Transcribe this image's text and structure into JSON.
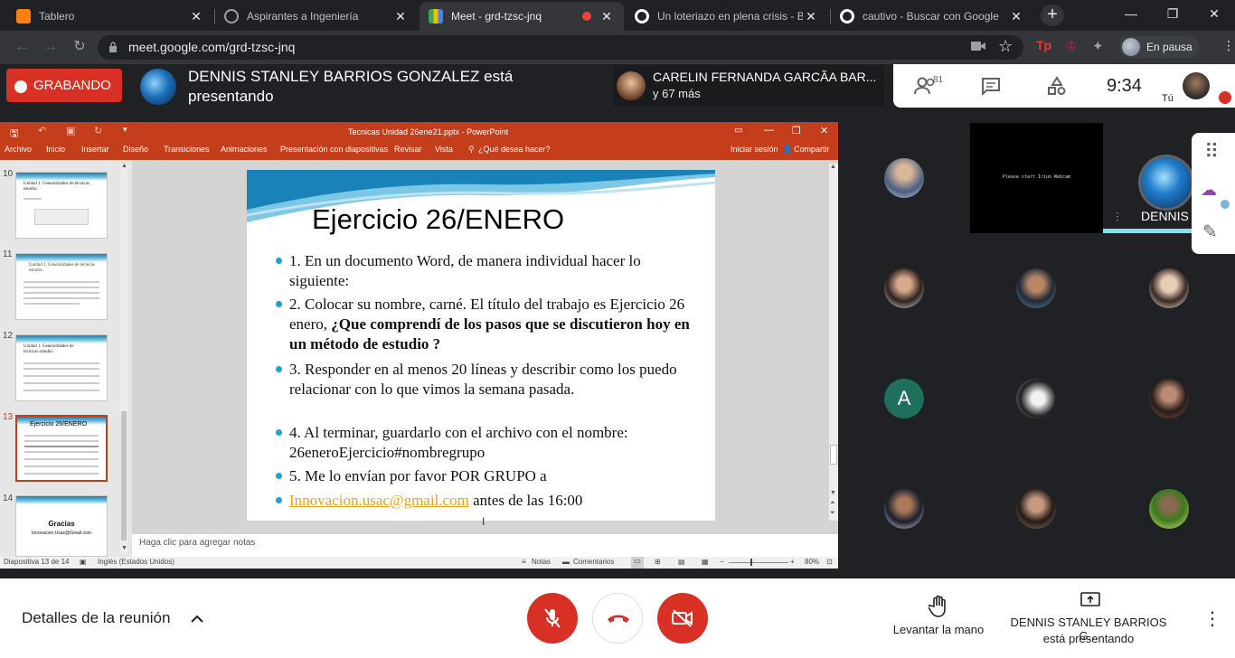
{
  "browser": {
    "tabs": [
      {
        "title": "Tablero",
        "icon": "moodle-icon"
      },
      {
        "title": "Aspirantes a Ingeniería",
        "icon": "globe-icon"
      },
      {
        "title": "Meet - grd-tzsc-jnq",
        "icon": "meet-icon"
      },
      {
        "title": "Un loteriazo en plena crisis - Bu",
        "icon": "google-icon"
      },
      {
        "title": "cautivo - Buscar con Google",
        "icon": "google-icon"
      }
    ],
    "url": "meet.google.com/grd-tzsc-jnq",
    "profile_status": "En pausa"
  },
  "meet": {
    "recording_label": "GRABANDO",
    "presenter_text": "DENNIS STANLEY BARRIOS GONZALEZ está presentando",
    "participants_name": "CARELIN FERNANDA GARCÃA BAR...",
    "participants_more": "y 67 más",
    "participant_count": "81",
    "time": "9:34",
    "self_label": "Tú",
    "tile_name": "DENNIS S",
    "tile_message": "Please start Iriun Webcam",
    "details_label": "Detalles de la reunión",
    "raise_hand_label": "Levantar la mano",
    "presenting_name": "DENNIS STANLEY BARRIOS G...",
    "presenting_sub": "está presentando",
    "grid_initial": "A"
  },
  "ppt": {
    "title": "Tecnicas Unidad 26ene21.pptx - PowerPoint",
    "ribbon": [
      "Archivo",
      "Inicio",
      "Insertar",
      "Diseño",
      "Transiciones",
      "Animaciones",
      "Presentación con diapositivas",
      "Revisar",
      "Vista"
    ],
    "tell_me": "¿Qué desea hacer?",
    "signin": "Iniciar sesión",
    "share": "Compartir",
    "thumbs": [
      {
        "num": "10",
        "title": "Unidad 1. Generalidades de técnicas estudio."
      },
      {
        "num": "11",
        "title": "Unidad 1. Generalidades de técnicas estudio."
      },
      {
        "num": "12",
        "title": "Unidad 1. Generalidades de técnicas estudio."
      },
      {
        "num": "13",
        "title": "Ejercicio 26/ENERO"
      },
      {
        "num": "14",
        "title": "Gracias",
        "sub": "Innovacion.Usac@Gmail.com"
      }
    ],
    "notes_placeholder": "Haga clic para agregar notas",
    "status_slide": "Diapositiva 13 de 14",
    "status_lang": "Inglés (Estados Unidos)",
    "status_notes": "Notas",
    "status_comments": "Comentarios",
    "zoom": "80%"
  },
  "slide": {
    "title": "Ejercicio 26/ENERO",
    "b1": "1. En un documento Word, de manera individual hacer lo siguiente:",
    "b2a": "2. Colocar su nombre, carné. El título del trabajo es Ejercicio 26 enero, ",
    "b2b": "¿Que comprendí de los pasos que se discutieron hoy en un método de estudio ?",
    "b3": "3. Responder en al menos 20 líneas y describir como los puedo relacionar con lo que vimos la semana pasada.",
    "b4": "4. Al terminar, guardarlo con el archivo con el nombre: 26eneroEjercicio#nombregrupo",
    "b5": "5. Me lo envían por favor POR GRUPO a",
    "b6_link": "Innovacion.usac@gmail.com",
    "b6_rest": " antes de las 16:00"
  }
}
